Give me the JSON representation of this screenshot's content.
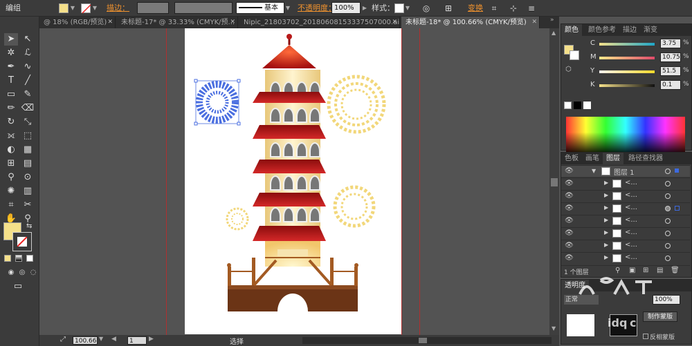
{
  "app": {
    "mode_label": "编组"
  },
  "control_bar": {
    "fill_color": "#f5e08a",
    "stroke_label": "描边：",
    "style_name": "基本",
    "opacity_label": "不透明度：",
    "opacity_value": "100%",
    "style_label": "样式：",
    "transform_label": "变换"
  },
  "tabs": [
    {
      "label": "@ 18% (RGB/预览)",
      "active": false
    },
    {
      "label": "未标题-17* @ 33.33% (CMYK/预...",
      "active": false
    },
    {
      "label": "Nipic_21803702_20180608153337507000.ai*",
      "active": false
    },
    {
      "label": "未标题-18* @ 100.66% (CMYK/预览)",
      "active": true
    }
  ],
  "status": {
    "zoom": "100.66",
    "artboard": "1",
    "tool": "选择"
  },
  "color_panel": {
    "tabs": [
      "颜色",
      "颜色参考",
      "描边",
      "渐变"
    ],
    "channels": [
      {
        "key": "C",
        "value": "3.75"
      },
      {
        "key": "M",
        "value": "10.75"
      },
      {
        "key": "Y",
        "value": "51.5"
      },
      {
        "key": "K",
        "value": "0.1"
      }
    ],
    "pct": "%"
  },
  "layers_panel": {
    "tabs": [
      "色板",
      "画笔",
      "图层",
      "路径查找器"
    ],
    "layer_name": "图层 1",
    "sublayer_label": "<...",
    "sublayer_count": 8,
    "footer": "1 个图层"
  },
  "transparency_panel": {
    "tab": "透明度",
    "mode": "正常",
    "opacity": "100%",
    "make_mask": "制作蒙版",
    "invert_mask": "反相蒙版"
  },
  "watermark": {
    "text_1": "yan",
    "text_2": "idq",
    "text_3": "c"
  },
  "colors": {
    "tower_red": "#b81a1a",
    "tower_cream": "#f6e4b0",
    "base_brown": "#6b3416",
    "firework_blue": "#4a6ee0",
    "firework_yellow": "#f2d77a",
    "guide_red": "#b03030"
  }
}
